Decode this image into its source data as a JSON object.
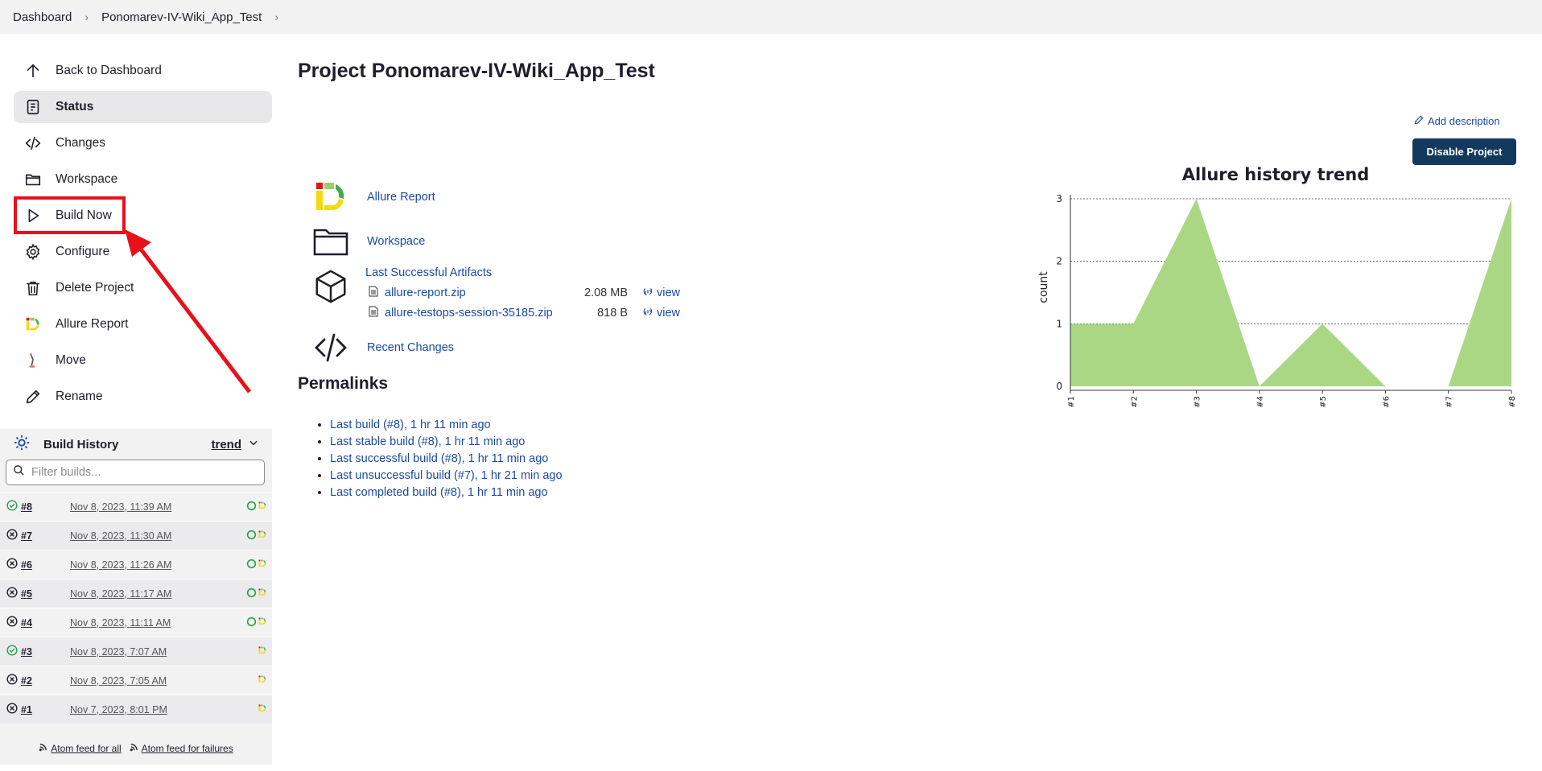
{
  "breadcrumb": [
    "Dashboard",
    "Ponomarev-IV-Wiki_App_Test"
  ],
  "side_tasks": [
    {
      "label": "Back to Dashboard",
      "icon": "arrow-up-icon"
    },
    {
      "label": "Status",
      "icon": "status-document-icon"
    },
    {
      "label": "Changes",
      "icon": "code-icon"
    },
    {
      "label": "Workspace",
      "icon": "folder-icon"
    },
    {
      "label": "Build Now",
      "icon": "play-icon"
    },
    {
      "label": "Configure",
      "icon": "gear-icon"
    },
    {
      "label": "Delete Project",
      "icon": "trash-icon"
    },
    {
      "label": "Allure Report",
      "icon": "allure-logo-icon"
    },
    {
      "label": "Move",
      "icon": "move-icon"
    },
    {
      "label": "Rename",
      "icon": "pencil-icon"
    }
  ],
  "build_history": {
    "title": "Build History",
    "trend_label": "trend",
    "filter_placeholder": "Filter builds...",
    "builds": [
      {
        "num": "#8",
        "date": "Nov 8, 2023, 11:39 AM",
        "status": "success"
      },
      {
        "num": "#7",
        "date": "Nov 8, 2023, 11:30 AM",
        "status": "failed"
      },
      {
        "num": "#6",
        "date": "Nov 8, 2023, 11:26 AM",
        "status": "failed"
      },
      {
        "num": "#5",
        "date": "Nov 8, 2023, 11:17 AM",
        "status": "failed"
      },
      {
        "num": "#4",
        "date": "Nov 8, 2023, 11:11 AM",
        "status": "failed"
      },
      {
        "num": "#3",
        "date": "Nov 8, 2023, 7:07 AM",
        "status": "success"
      },
      {
        "num": "#2",
        "date": "Nov 8, 2023, 7:05 AM",
        "status": "failed"
      },
      {
        "num": "#1",
        "date": "Nov 7, 2023, 8:01 PM",
        "status": "failed"
      }
    ],
    "feed_all": "Atom feed for all",
    "feed_failures": "Atom feed for failures"
  },
  "main": {
    "title": "Project Ponomarev-IV-Wiki_App_Test",
    "add_description": "Add description",
    "disable_button": "Disable Project",
    "links": {
      "allure_report": "Allure Report",
      "workspace": "Workspace",
      "last_successful_artifacts": "Last Successful Artifacts",
      "recent_changes": "Recent Changes"
    },
    "artifacts": [
      {
        "name": "allure-report.zip",
        "size": "2.08 MB",
        "view": "view"
      },
      {
        "name": "allure-testops-session-35185.zip",
        "size": "818 B",
        "view": "view"
      }
    ],
    "permalinks_title": "Permalinks",
    "permalinks": [
      "Last build (#8), 1 hr 11 min ago",
      "Last stable build (#8), 1 hr 11 min ago",
      "Last successful build (#8), 1 hr 11 min ago",
      "Last unsuccessful build (#7), 1 hr 21 min ago",
      "Last completed build (#8), 1 hr 11 min ago"
    ]
  },
  "chart_data": {
    "type": "area",
    "title": "Allure history trend",
    "ylabel": "count",
    "xlabel": "",
    "categories": [
      "#1",
      "#2",
      "#3",
      "#4",
      "#5",
      "#6",
      "#7",
      "#8"
    ],
    "series": [
      {
        "values": [
          1,
          1,
          3,
          0,
          1,
          0,
          0,
          3
        ],
        "color": "#a9d783"
      }
    ],
    "ylim": [
      0,
      3
    ],
    "yticks": [
      0,
      1,
      2,
      3
    ],
    "grid": true
  },
  "colors": {
    "accent_link": "#1b49a8",
    "button": "#14395e",
    "annotation_red": "#e8111b",
    "success": "#1ea446"
  }
}
